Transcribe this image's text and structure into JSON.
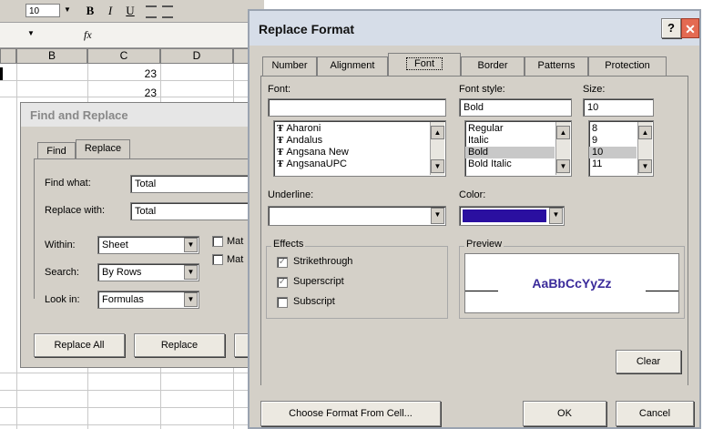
{
  "excel": {
    "font_size": "10",
    "bold_btn": "B",
    "italic_btn": "I",
    "underline_btn": "U",
    "fx": "fx",
    "columns": [
      "B",
      "C",
      "D"
    ],
    "cell_values": [
      "23",
      "23"
    ]
  },
  "find_replace": {
    "title": "Find and Replace",
    "tabs": [
      "Find",
      "Replace"
    ],
    "find_what_label": "Find what:",
    "find_what_value": "Total",
    "replace_with_label": "Replace with:",
    "replace_with_value": "Total",
    "within_label": "Within:",
    "within_value": "Sheet",
    "search_label": "Search:",
    "search_value": "By Rows",
    "lookin_label": "Look in:",
    "lookin_value": "Formulas",
    "match_case_label": "Mat",
    "match_entire_label": "Mat",
    "replace_all_label": "Replace All",
    "replace_label": "Replace"
  },
  "replace_format": {
    "title": "Replace Format",
    "help_icon": "question-mark",
    "close_icon": "x",
    "tabs": [
      "Number",
      "Alignment",
      "Font",
      "Border",
      "Patterns",
      "Protection"
    ],
    "font_label": "Font:",
    "font_value": "",
    "font_list": [
      "Aharoni",
      "Andalus",
      "Angsana New",
      "AngsanaUPC"
    ],
    "font_style_label": "Font style:",
    "font_style_value": "Bold",
    "font_style_list": [
      "Regular",
      "Italic",
      "Bold",
      "Bold Italic"
    ],
    "size_label": "Size:",
    "size_value": "10",
    "size_list": [
      "8",
      "9",
      "10",
      "11"
    ],
    "underline_label": "Underline:",
    "underline_value": "",
    "color_label": "Color:",
    "color_value": "#2a0fa0",
    "effects_label": "Effects",
    "strikethrough_label": "Strikethrough",
    "superscript_label": "Superscript",
    "subscript_label": "Subscript",
    "preview_label": "Preview",
    "preview_text": "AaBbCcYyZz",
    "preview_color": "#3a2a9a",
    "clear_label": "Clear",
    "choose_format_label": "Choose Format From Cell...",
    "ok_label": "OK",
    "cancel_label": "Cancel",
    "title_bar_color": "#d6dde8",
    "selected_item_color": "#c8c8c8"
  }
}
